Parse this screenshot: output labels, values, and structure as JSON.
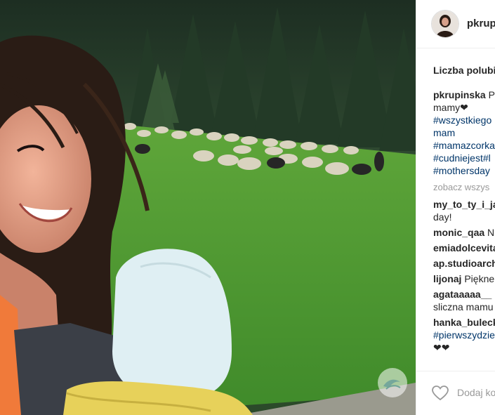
{
  "post": {
    "username": "pkrupi",
    "likes_label": "Liczba polubi",
    "caption": {
      "user": "pkrupinska",
      "text_1": "Pi",
      "line2": "mamy❤",
      "hashtags": [
        "#wszystkiego",
        "mam",
        "#mamazcorka",
        "#cudniejest#l",
        "#mothersday"
      ]
    },
    "view_all_label": "zobacz wszys",
    "comments": [
      {
        "user": "my_to_ty_i_ja",
        "text": "",
        "cont": "day!"
      },
      {
        "user": "monic_qaa",
        "text": "N",
        "cont": ""
      },
      {
        "user": "emiadolcevita",
        "text": "",
        "cont": ""
      },
      {
        "user": "ap.studioarch",
        "text": "",
        "cont": ""
      },
      {
        "user": "lijonaj",
        "text": "Piękne",
        "cont": ""
      },
      {
        "user": "agataaaaa__",
        "text": "",
        "cont": "sliczna mamu"
      },
      {
        "user": "hanka_bulecka",
        "text": "",
        "cont": "#pierwszydzie",
        "cont2": "❤❤"
      }
    ],
    "add_comment_placeholder": "Dodaj ko"
  },
  "icons": {
    "like": "heart-outline-icon",
    "watermark": "watermark-logo-icon"
  },
  "colors": {
    "hashtag": "#003569",
    "text": "#262626",
    "muted": "#999999"
  }
}
